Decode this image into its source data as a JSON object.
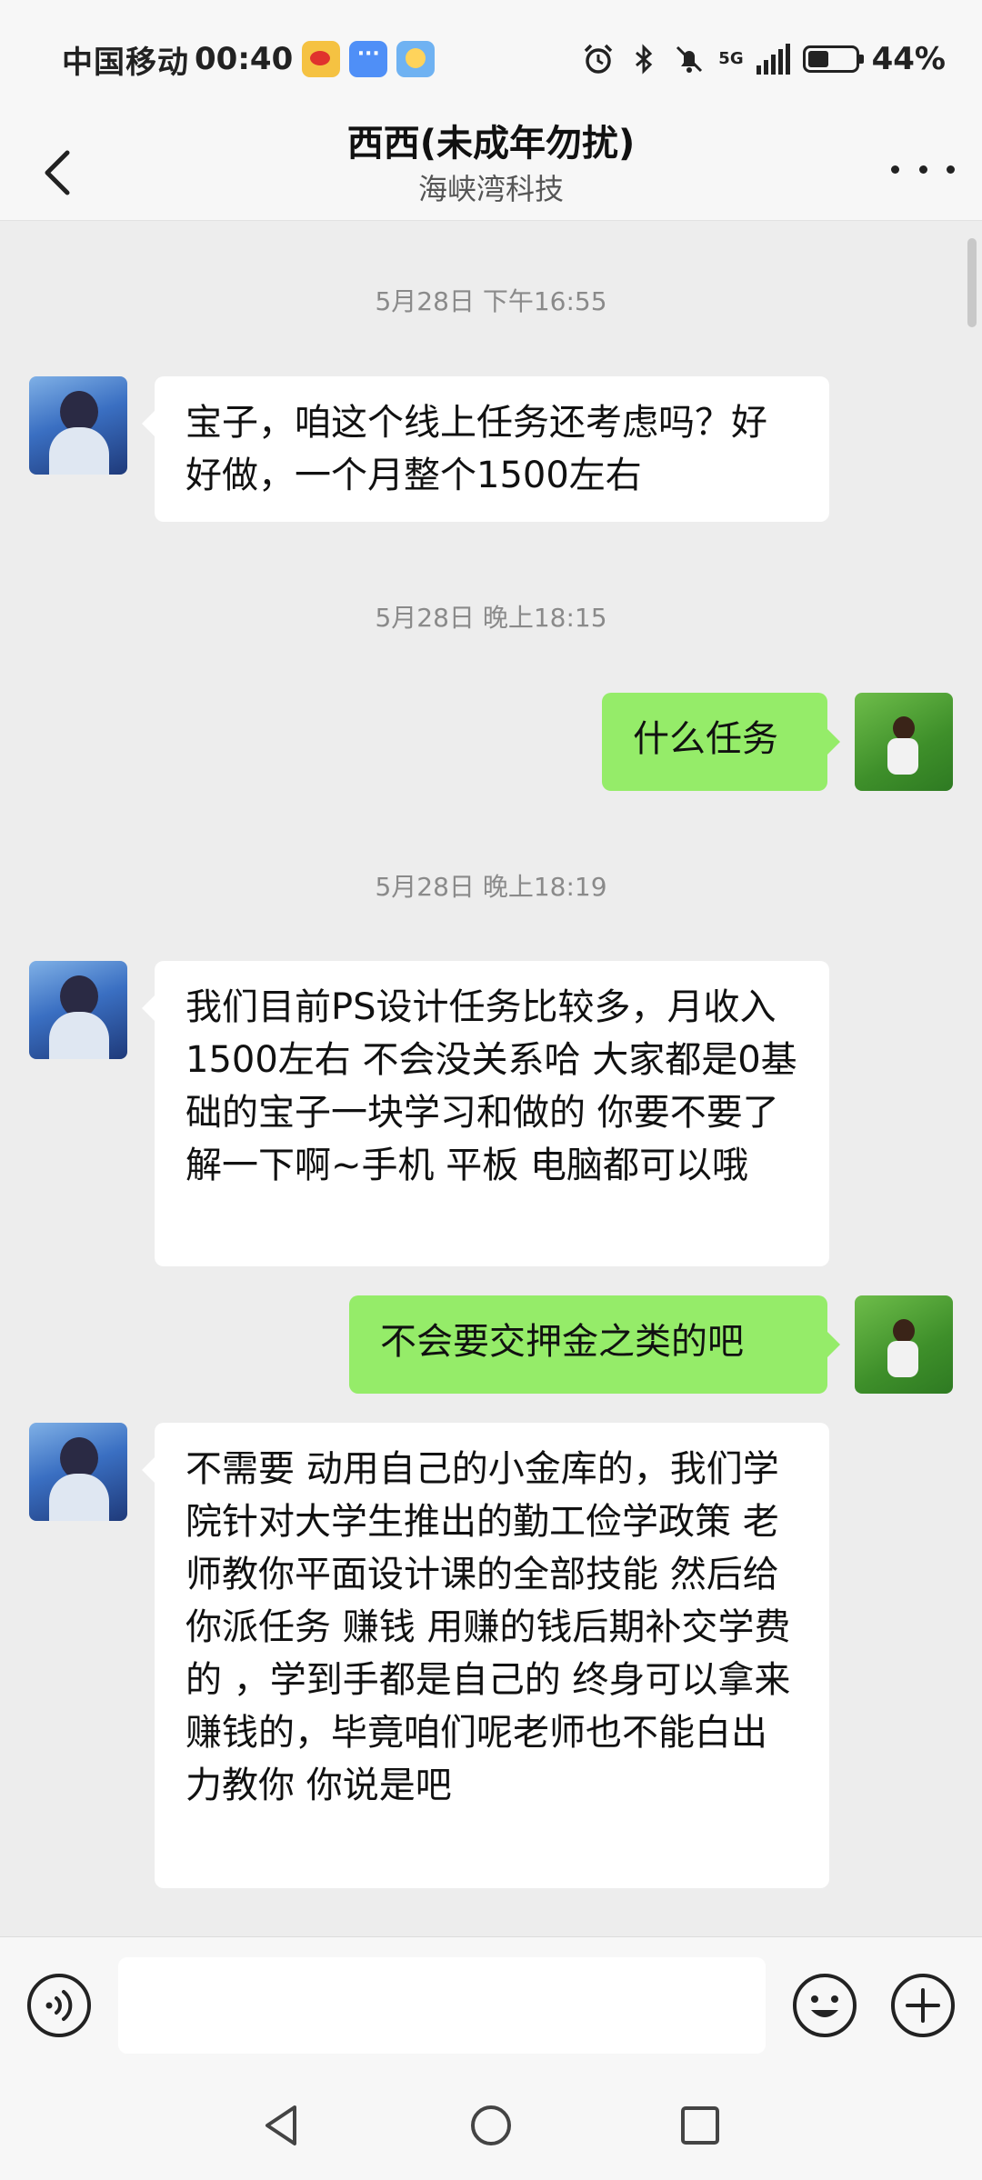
{
  "status_bar": {
    "carrier": "中国移动",
    "time": "00:40",
    "network_label": "5G",
    "battery_level_percent": 44,
    "battery_text": "44%"
  },
  "header": {
    "title": "西西(未成年勿扰)",
    "subtitle": "海峡湾科技"
  },
  "messages": [
    {
      "type": "timestamp",
      "text": "5月28日 下午16:55"
    },
    {
      "type": "message",
      "sender": "other",
      "text": "宝子，咱这个线上任务还考虑吗？好好做，一个月整个1500左右"
    },
    {
      "type": "timestamp",
      "text": "5月28日 晚上18:15"
    },
    {
      "type": "message",
      "sender": "self",
      "text": "什么任务"
    },
    {
      "type": "timestamp",
      "text": "5月28日 晚上18:19"
    },
    {
      "type": "message",
      "sender": "other",
      "text": "我们目前PS设计任务比较多，月收入1500左右 不会没关系哈 大家都是0基础的宝子一块学习和做的 你要不要了解一下啊~手机 平板 电脑都可以哦"
    },
    {
      "type": "message",
      "sender": "self",
      "text": "不会要交押金之类的吧"
    },
    {
      "type": "message",
      "sender": "other",
      "text": "不需要 动用自己的小金库的，我们学院针对大学生推出的勤工俭学政策  老师教你平面设计课的全部技能  然后给你派任务 赚钱  用赚的钱后期补交学费的 ，学到手都是自己的  终身可以拿来赚钱的，毕竟咱们呢老师也不能白出力教你 你说是吧"
    }
  ],
  "input_bar": {
    "placeholder": ""
  },
  "icons": {
    "back": "chevron-left-icon",
    "more": "more-dots-icon",
    "voice": "voice-icon",
    "emoji": "emoji-icon",
    "plus": "plus-icon",
    "nav_back": "triangle-back-icon",
    "nav_home": "circle-home-icon",
    "nav_recent": "square-recent-icon"
  },
  "colors": {
    "self_bubble": "#95ec69",
    "other_bubble": "#ffffff",
    "background": "#ededed"
  }
}
